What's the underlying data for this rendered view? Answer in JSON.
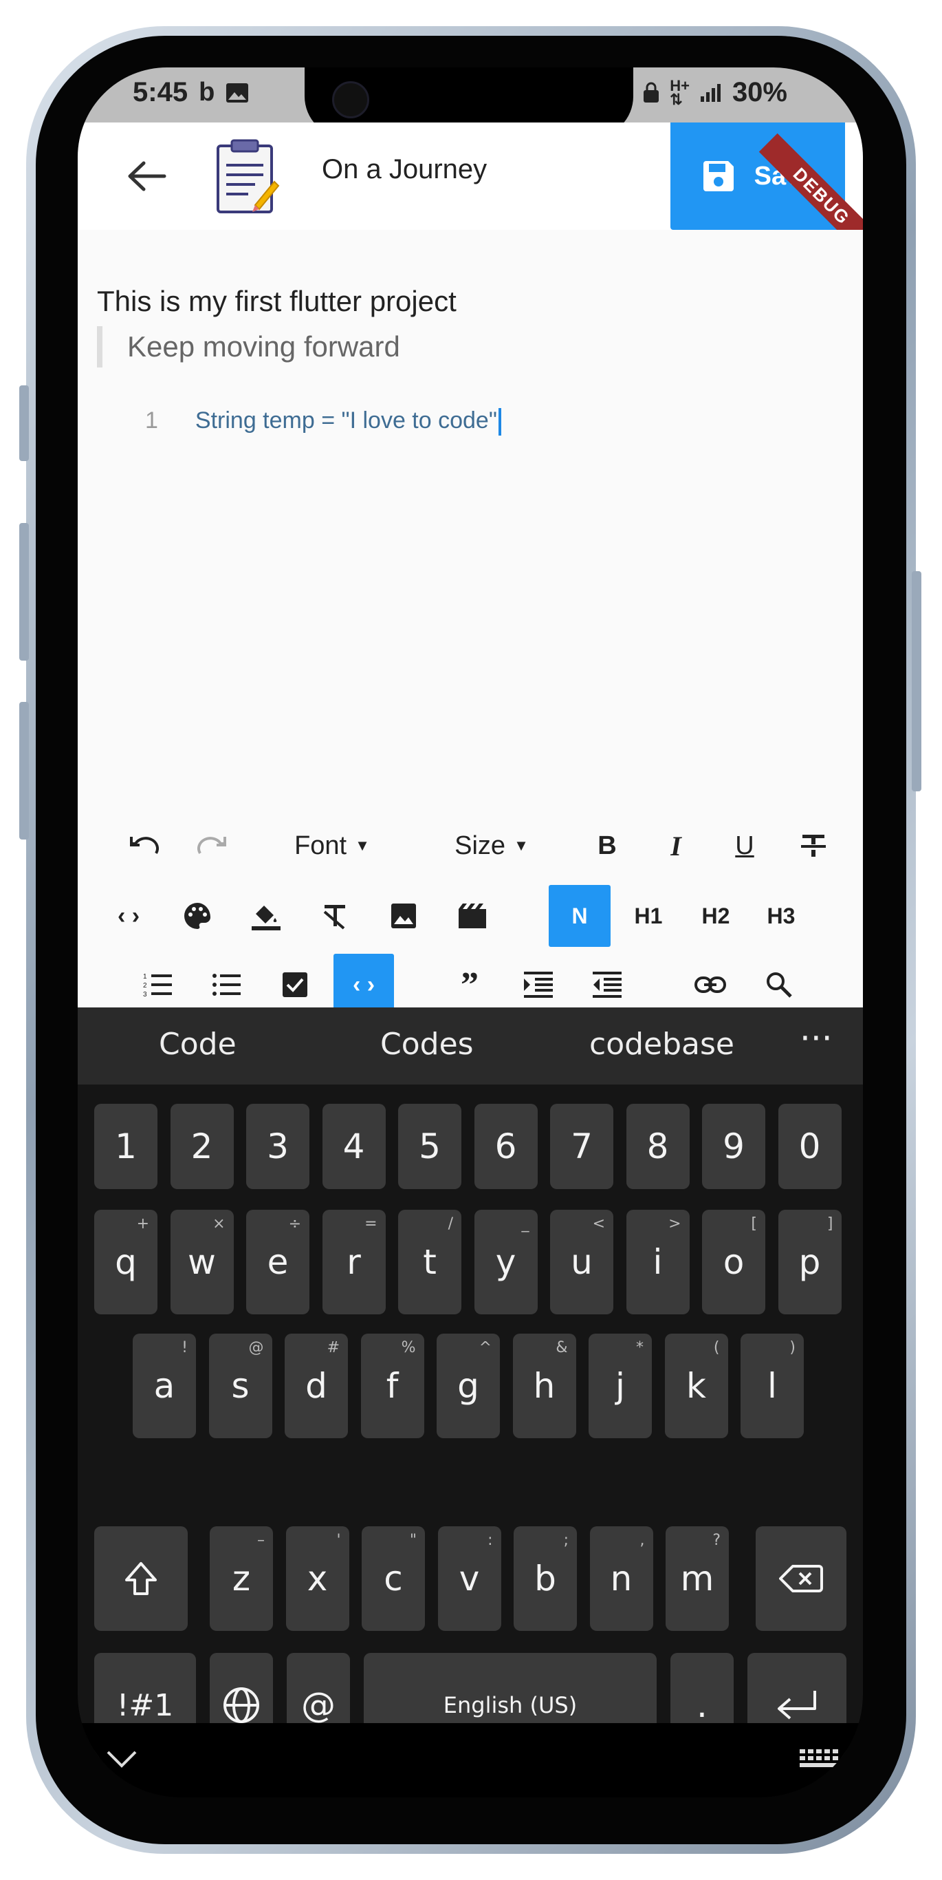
{
  "status_bar": {
    "time": "5:45",
    "battery": "30%"
  },
  "appbar": {
    "title": "On a Journey",
    "save_label": "Save",
    "debug_label": "DEBUG"
  },
  "editor": {
    "line1": "This is my first flutter project",
    "quote": "Keep moving forward",
    "code_line_number": "1",
    "code_text": "String temp = \"I love to code\""
  },
  "toolbar": {
    "font_label": "Font",
    "size_label": "Size",
    "bold": "B",
    "italic": "I",
    "underline": "U",
    "normal": "N",
    "h1": "H1",
    "h2": "H2",
    "h3": "H3"
  },
  "keyboard": {
    "suggestions": [
      "Code",
      "Codes",
      "codebase"
    ],
    "number_row": [
      "1",
      "2",
      "3",
      "4",
      "5",
      "6",
      "7",
      "8",
      "9",
      "0"
    ],
    "row1": [
      {
        "k": "q",
        "h": "+"
      },
      {
        "k": "w",
        "h": "×"
      },
      {
        "k": "e",
        "h": "÷"
      },
      {
        "k": "r",
        "h": "="
      },
      {
        "k": "t",
        "h": "/"
      },
      {
        "k": "y",
        "h": "_"
      },
      {
        "k": "u",
        "h": "<"
      },
      {
        "k": "i",
        "h": ">"
      },
      {
        "k": "o",
        "h": "["
      },
      {
        "k": "p",
        "h": "]"
      }
    ],
    "row2": [
      {
        "k": "a",
        "h": "!"
      },
      {
        "k": "s",
        "h": "@"
      },
      {
        "k": "d",
        "h": "#"
      },
      {
        "k": "f",
        "h": "%"
      },
      {
        "k": "g",
        "h": "^"
      },
      {
        "k": "h",
        "h": "&"
      },
      {
        "k": "j",
        "h": "*"
      },
      {
        "k": "k",
        "h": "("
      },
      {
        "k": "l",
        "h": ")"
      }
    ],
    "row3": [
      {
        "k": "z",
        "h": "–"
      },
      {
        "k": "x",
        "h": "'"
      },
      {
        "k": "c",
        "h": "\""
      },
      {
        "k": "v",
        "h": ":"
      },
      {
        "k": "b",
        "h": ";"
      },
      {
        "k": "n",
        "h": ","
      },
      {
        "k": "m",
        "h": "?"
      }
    ],
    "symbols_label": "!#1",
    "at_label": "@",
    "space_label": "English (US)",
    "period_label": "."
  },
  "colors": {
    "accent": "#2196f3",
    "keyboard_bg": "#151515",
    "key_bg": "#3a3a3a"
  }
}
